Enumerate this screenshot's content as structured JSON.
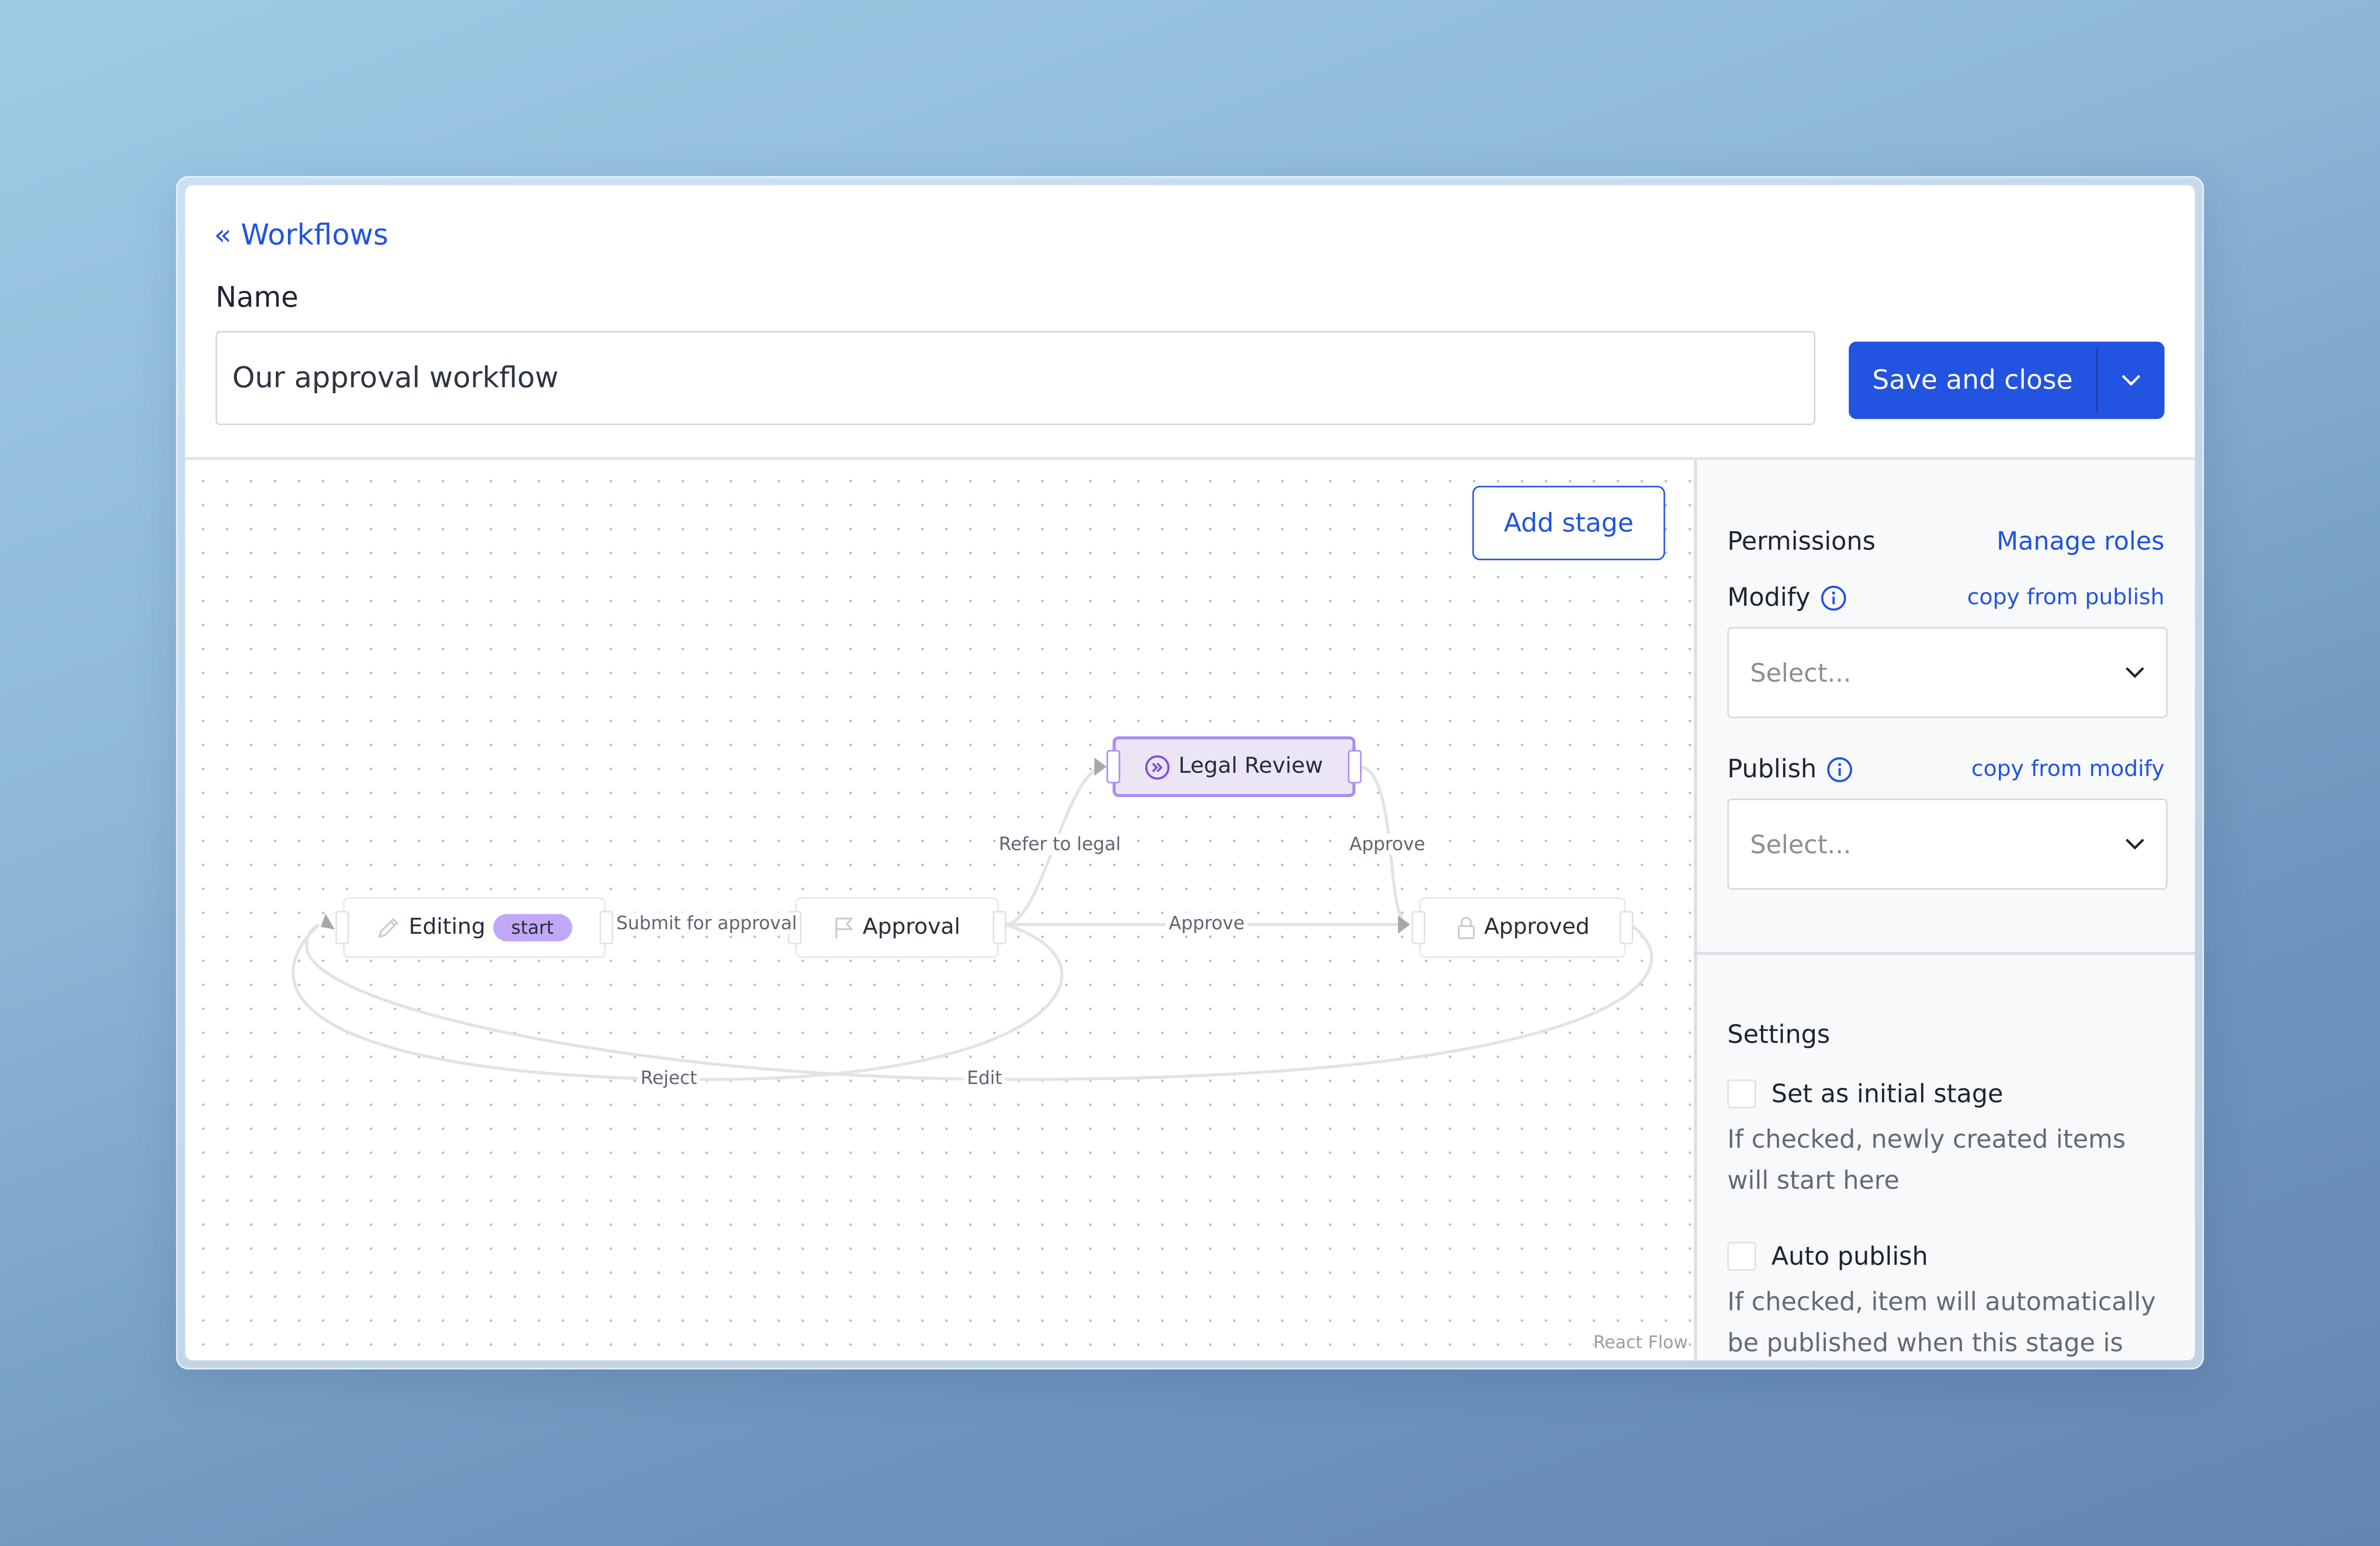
{
  "header": {
    "back_link": "« Workflows",
    "name_label": "Name",
    "name_value": "Our approval workflow",
    "save_label": "Save and close",
    "save_menu_icon": "chevron-down-icon"
  },
  "canvas": {
    "add_stage_label": "Add stage",
    "attribution": "React Flow",
    "nodes": [
      {
        "id": "editing",
        "label": "Editing",
        "icon": "pencil-icon",
        "badge": "start"
      },
      {
        "id": "approval",
        "label": "Approval",
        "icon": "flag-icon"
      },
      {
        "id": "legal-review",
        "label": "Legal Review",
        "icon": "chevrons-right-circle-icon",
        "selected": true
      },
      {
        "id": "approved",
        "label": "Approved",
        "icon": "lock-icon"
      }
    ],
    "edges": [
      {
        "from": "editing",
        "to": "approval",
        "label": "Submit for approval"
      },
      {
        "from": "approval",
        "to": "legal-review",
        "label": "Refer to legal"
      },
      {
        "from": "legal-review",
        "to": "approved",
        "label": "Approve"
      },
      {
        "from": "approval",
        "to": "approved",
        "label": "Approve"
      },
      {
        "from": "approval",
        "to": "editing",
        "label": "Reject"
      },
      {
        "from": "approved",
        "to": "editing",
        "label": "Edit"
      }
    ]
  },
  "sidebar": {
    "permissions": {
      "title": "Permissions",
      "manage_roles": "Manage roles",
      "modify": {
        "label": "Modify",
        "copy_link": "copy from publish",
        "placeholder": "Select..."
      },
      "publish": {
        "label": "Publish",
        "copy_link": "copy from modify",
        "placeholder": "Select..."
      }
    },
    "settings": {
      "title": "Settings",
      "initial_stage": {
        "label": "Set as initial stage",
        "checked": false,
        "help": "If checked, newly created items will start here"
      },
      "auto_publish": {
        "label": "Auto publish",
        "checked": false,
        "help": "If checked, item will automatically be published when this stage is"
      }
    }
  },
  "colors": {
    "accent": "#2253e1",
    "selected_node_bg": "#ebe5f6",
    "selected_node_border": "#a98ef0",
    "badge": "#c0a8f7",
    "edge": "#e2e3e7"
  }
}
